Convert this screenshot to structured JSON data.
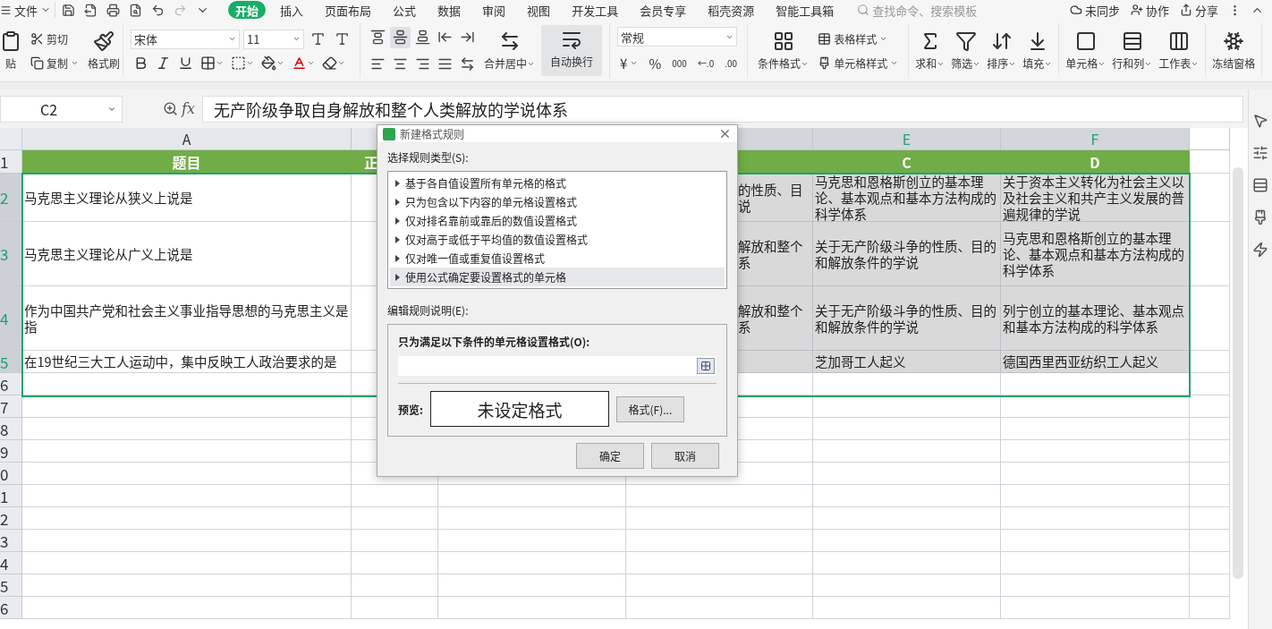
{
  "menu": {
    "label": "文件"
  },
  "quick_access": [
    {
      "kind": "save",
      "disabled": false
    },
    {
      "kind": "export",
      "disabled": false
    },
    {
      "kind": "print",
      "disabled": false
    },
    {
      "kind": "preview",
      "disabled": false
    },
    {
      "kind": "undo",
      "disabled": false
    },
    {
      "kind": "redo",
      "disabled": true
    },
    {
      "kind": "more",
      "disabled": false
    }
  ],
  "tabs": [
    {
      "label": "开始",
      "selected": true
    },
    {
      "label": "插入",
      "selected": false
    },
    {
      "label": "页面布局",
      "selected": false
    },
    {
      "label": "公式",
      "selected": false
    },
    {
      "label": "数据",
      "selected": false
    },
    {
      "label": "审阅",
      "selected": false
    },
    {
      "label": "视图",
      "selected": false
    },
    {
      "label": "开发工具",
      "selected": false
    },
    {
      "label": "会员专享",
      "selected": false
    },
    {
      "label": "稻壳资源",
      "selected": false
    },
    {
      "label": "智能工具箱",
      "selected": false
    }
  ],
  "search": {
    "placeholder": "查找命令、搜索模板"
  },
  "account_actions": [
    {
      "kind": "sync",
      "label": "未同步"
    },
    {
      "kind": "collab",
      "label": "协作"
    },
    {
      "kind": "share",
      "label": "分享"
    }
  ],
  "ribbon": {
    "clipboard": [
      {
        "kind": "paste",
        "label": "贴"
      },
      {
        "kind": "cut",
        "label": "剪切"
      },
      {
        "kind": "copy",
        "label": "复制"
      },
      {
        "kind": "painter",
        "label": "格式刷"
      }
    ],
    "font": {
      "family": "宋体",
      "size": "11"
    },
    "font_tools": [
      {
        "kind": "grow"
      },
      {
        "kind": "shrink"
      },
      {
        "kind": "bold"
      },
      {
        "kind": "italic"
      },
      {
        "kind": "underline"
      },
      {
        "kind": "border"
      },
      {
        "kind": "fill"
      },
      {
        "kind": "highlight"
      },
      {
        "kind": "color"
      },
      {
        "kind": "eraser"
      }
    ],
    "align_tools": [
      {
        "kind": "top",
        "selected": false
      },
      {
        "kind": "middle",
        "selected": true
      },
      {
        "kind": "bottom",
        "selected": false
      },
      {
        "kind": "outdent",
        "selected": false
      },
      {
        "kind": "indent",
        "selected": false
      },
      {
        "kind": "left",
        "selected": false
      },
      {
        "kind": "center",
        "selected": false
      },
      {
        "kind": "right",
        "selected": false
      },
      {
        "kind": "justify",
        "selected": false
      },
      {
        "kind": "distribute",
        "selected": false
      }
    ],
    "merge": {
      "label": "合并居中",
      "selected": false
    },
    "wrap": {
      "label": "自动换行",
      "selected": true
    },
    "number_format": "常规",
    "number_tools": [
      {
        "kind": "currency",
        "label": "¥"
      },
      {
        "kind": "percent",
        "label": "%"
      },
      {
        "kind": "thousands",
        "label": "000"
      },
      {
        "kind": "increase",
        "label": "←.0"
      },
      {
        "kind": "decrease",
        "label": ".00"
      }
    ],
    "styles": [
      {
        "kind": "conditional",
        "label": "条件格式"
      },
      {
        "kind": "table",
        "label": "表格样式"
      },
      {
        "kind": "cell",
        "label": "单元格样式"
      }
    ],
    "editing": [
      {
        "kind": "sum",
        "label": "求和"
      },
      {
        "kind": "filter",
        "label": "筛选"
      },
      {
        "kind": "sort",
        "label": "排序"
      },
      {
        "kind": "fill",
        "label": "填充"
      },
      {
        "kind": "cells",
        "label": "单元格"
      },
      {
        "kind": "rowcol",
        "label": "行和列"
      },
      {
        "kind": "sheet",
        "label": "工作表"
      },
      {
        "kind": "freeze",
        "label": "冻结窗格"
      }
    ]
  },
  "formula_bar": {
    "cell_ref": "C2",
    "fx_label": "fx",
    "value": "无产阶级争取自身解放和整个人类解放的学说体系"
  },
  "columns": [
    {
      "label": "A",
      "selected": false
    },
    {
      "selected": false
    },
    null,
    {
      "selected": true
    },
    {
      "label": "E",
      "selected": true
    },
    {
      "label": "F",
      "selected": true
    }
  ],
  "rows": [
    {
      "number": "1",
      "selected": false,
      "kind": "header",
      "cells": [
        "题目",
        "正",
        null,
        null,
        "C",
        "D"
      ]
    },
    {
      "number": "2",
      "selected": true,
      "kind": "data",
      "cells": [
        "马克思主义理论从狭义上说是",
        null,
        null,
        "的性质、目说",
        "马克思和恩格斯创立的基本理论、基本观点和基本方法构成的科学体系",
        "关于资本主义转化为社会主义以及社会主义和共产主义发展的普遍规律的学说"
      ]
    },
    {
      "number": "3",
      "selected": true,
      "kind": "data",
      "cells": [
        "马克思主义理论从广义上说是",
        null,
        null,
        "解放和整个系",
        "关于无产阶级斗争的性质、目的和解放条件的学说",
        "马克思和恩格斯创立的基本理论、基本观点和基本方法构成的科学体系"
      ]
    },
    {
      "number": "4",
      "selected": true,
      "kind": "data",
      "cells": [
        "作为中国共产党和社会主义事业指导思想的马克思主义是指",
        null,
        null,
        "解放和整个系",
        "关于无产阶级斗争的性质、目的和解放条件的学说",
        "列宁创立的基本理论、基本观点和基本方法构成的科学体系"
      ]
    },
    {
      "number": "5",
      "selected": true,
      "kind": "data",
      "cells": [
        "在19世纪三大工人运动中，集中反映工人政治要求的是",
        null,
        null,
        null,
        "芝加哥工人起义",
        "德国西里西亚纺织工人起义"
      ]
    },
    {
      "number": "6",
      "selected": false,
      "kind": "empty"
    },
    {
      "number": "7",
      "selected": false,
      "kind": "empty"
    },
    {
      "number": "8",
      "selected": false,
      "kind": "empty"
    },
    {
      "number": "9",
      "selected": false,
      "kind": "empty"
    },
    {
      "number": "0",
      "selected": false,
      "kind": "empty"
    },
    {
      "number": "1",
      "selected": false,
      "kind": "empty"
    },
    {
      "number": "2",
      "selected": false,
      "kind": "empty"
    },
    {
      "number": "3",
      "selected": false,
      "kind": "empty"
    },
    {
      "number": "4",
      "selected": false,
      "kind": "empty"
    },
    {
      "number": "5",
      "selected": false,
      "kind": "empty"
    },
    {
      "number": "6",
      "selected": false,
      "kind": "empty"
    }
  ],
  "dialog": {
    "title": "新建格式规则",
    "rule_type_label": "选择规则类型(S):",
    "rule_types": [
      {
        "label": "基于各自值设置所有单元格的格式",
        "selected": false
      },
      {
        "label": "只为包含以下内容的单元格设置格式",
        "selected": false
      },
      {
        "label": "仅对排名靠前或靠后的数值设置格式",
        "selected": false
      },
      {
        "label": "仅对高于或低于平均值的数值设置格式",
        "selected": false
      },
      {
        "label": "仅对唯一值或重复值设置格式",
        "selected": false
      },
      {
        "label": "使用公式确定要设置格式的单元格",
        "selected": true
      }
    ],
    "description_label": "编辑规则说明(E):",
    "condition_label": "只为满足以下条件的单元格设置格式(O):",
    "preview_label": "预览:",
    "preview_text": "未设定格式",
    "format_button": "格式(F)...",
    "ok": "确定",
    "cancel": "取消"
  }
}
